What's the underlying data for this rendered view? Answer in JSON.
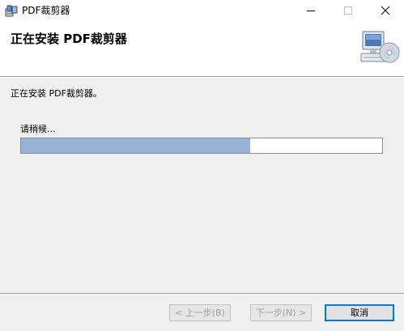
{
  "window": {
    "title": "PDF裁剪器",
    "app_icon": "installer-package-icon",
    "controls": [
      "minimize-icon",
      "maximize-icon",
      "close-icon"
    ]
  },
  "banner": {
    "heading": "正在安装 PDF裁剪器",
    "graphic": "computer-disc-icon"
  },
  "content": {
    "status": "正在安装 PDF裁剪器。",
    "wait_label": "请稍候...",
    "progress_fraction": 0.635
  },
  "footer": {
    "back_label": "< 上一步(B)",
    "next_label": "下一步(N) >",
    "cancel_label": "取消"
  },
  "colors": {
    "progress_fill": "#99b3d4",
    "focus_border": "#0078d7",
    "content_bg": "#f0f0f0"
  }
}
